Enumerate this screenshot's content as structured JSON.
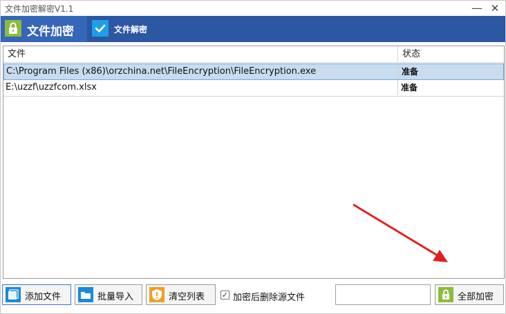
{
  "window": {
    "title": "文件加密解密V1.1",
    "minimize_glyph": "—",
    "close_glyph": "✕"
  },
  "tabs": [
    {
      "label": "文件加密",
      "icon": "lock-icon",
      "active": true
    },
    {
      "label": "文件解密",
      "icon": "checkmark-icon",
      "active": false
    }
  ],
  "table": {
    "columns": [
      "文件",
      "状态"
    ],
    "rows": [
      {
        "file": "C:\\Program Files (x86)\\orzchina.net\\FileEncryption\\FileEncryption.exe",
        "status": "准备",
        "selected": true
      },
      {
        "file": "E:\\uzzf\\uzzfcom.xlsx",
        "status": "准备",
        "selected": false
      }
    ]
  },
  "toolbar": {
    "add_label": "添加文件",
    "import_label": "批量导入",
    "clear_label": "清空列表",
    "delete_source_label": "加密后删除源文件",
    "delete_source_checked": true,
    "password_value": "",
    "encrypt_all_label": "全部加密"
  },
  "colors": {
    "header_bg": "#2b57a3",
    "lock_green": "#8cbc3a",
    "blue_icon": "#1a8ad6",
    "warn_orange": "#f0a020",
    "arrow_red": "#e02020"
  }
}
